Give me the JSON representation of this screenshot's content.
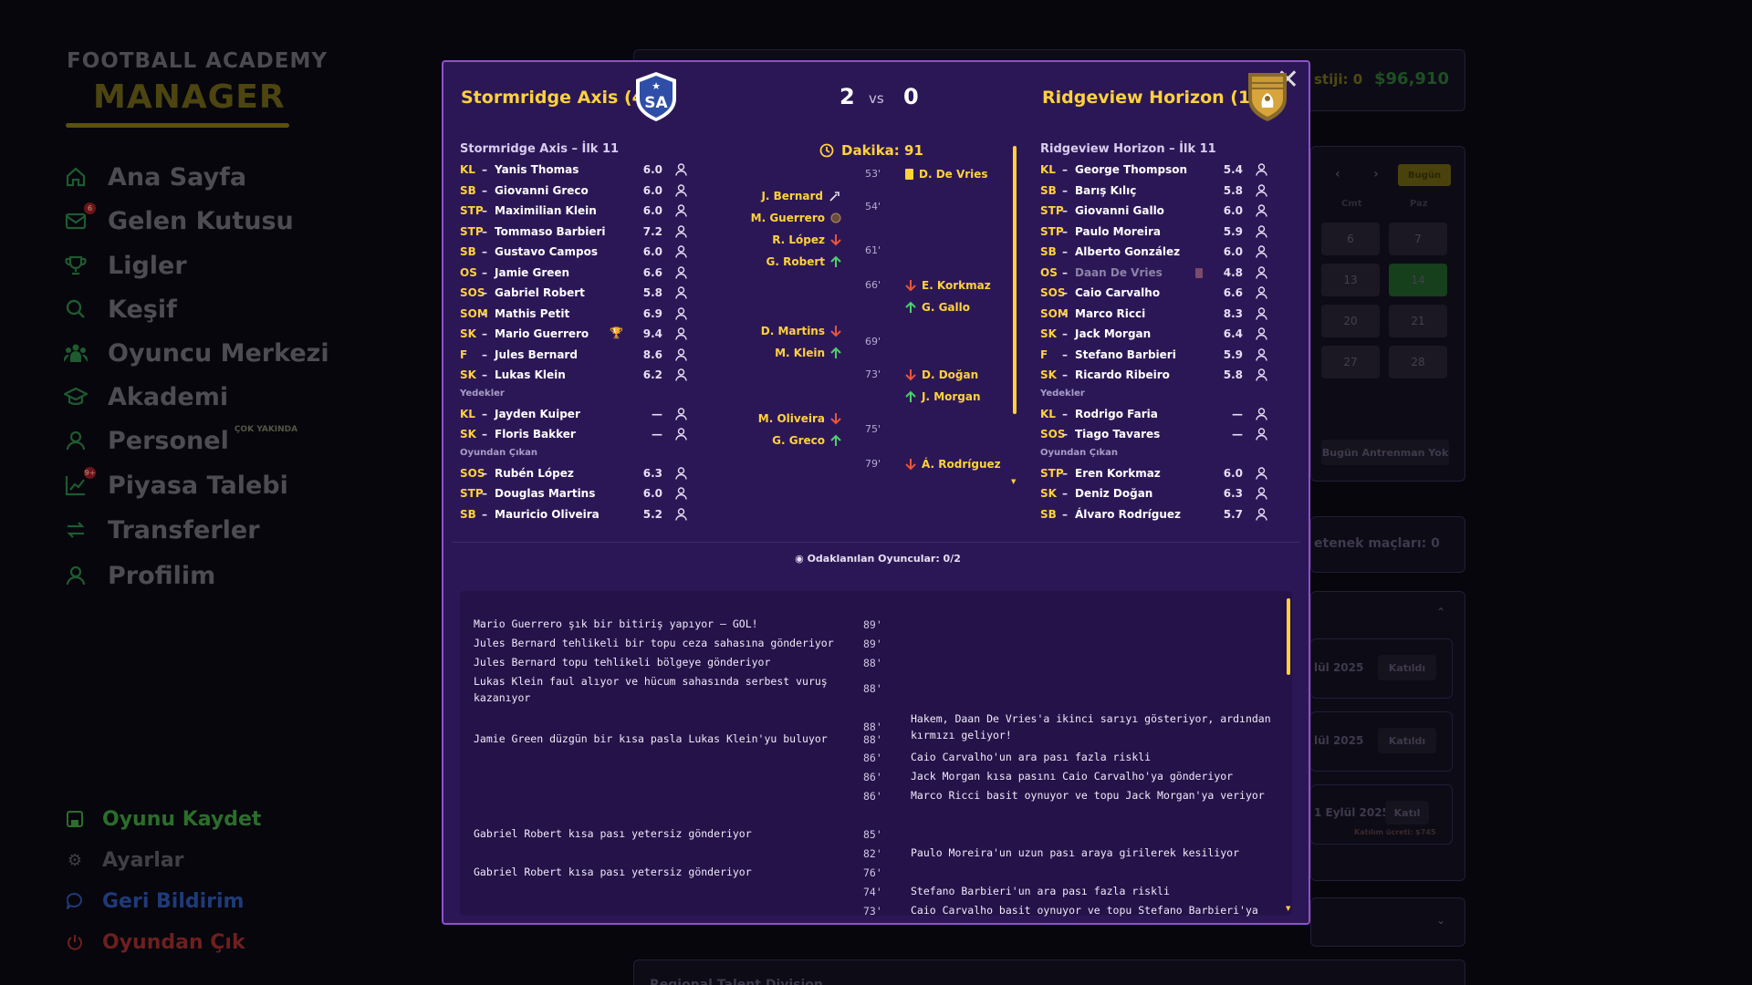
{
  "sidebar": {
    "logo_top": "FOOTBALL ACADEMY",
    "logo_main": "MANAGER",
    "items": [
      {
        "label": "Ana Sayfa"
      },
      {
        "label": "Gelen Kutusu",
        "badge": "6"
      },
      {
        "label": "Ligler"
      },
      {
        "label": "Keşif"
      },
      {
        "label": "Oyuncu Merkezi"
      },
      {
        "label": "Akademi"
      },
      {
        "label": "Personel",
        "note": "ÇOK YAKINDA"
      },
      {
        "label": "Piyasa Talebi",
        "badge": "9+"
      },
      {
        "label": "Transferler"
      },
      {
        "label": "Profilim"
      }
    ],
    "bottom": [
      {
        "label": "Oyunu Kaydet",
        "color": "#2a6e2a"
      },
      {
        "label": "Ayarlar",
        "color": "#3f3f45"
      },
      {
        "label": "Geri Bildirim",
        "color": "#1f3a78"
      },
      {
        "label": "Oyundan Çık",
        "color": "#6e1f1f"
      }
    ]
  },
  "background": {
    "prestige": "stiji: 0",
    "money": "$96,910",
    "today": "Bugün",
    "cal_head": [
      "Cmt",
      "Paz"
    ],
    "cal_days": [
      "6",
      "7",
      "13",
      "14",
      "20",
      "21",
      "27",
      "28"
    ],
    "no_training": "Bugün Antrenman Yok",
    "upcoming": "etenek maçları: 0",
    "rows": [
      {
        "date": "lül 2025",
        "btn": "Katıldı"
      },
      {
        "date": "lül 2025",
        "btn": "Katıldı"
      },
      {
        "date": "1 Eylül 2025",
        "btn": "Katıl",
        "fee": "Katılım ücreti: $745"
      }
    ],
    "bottom_title": "Regional Talent Division"
  },
  "match": {
    "home": {
      "name": "Stormridge Axis (4.)",
      "score": "2",
      "abbr": "SA"
    },
    "away": {
      "name": "Ridgeview Horizon (18.)",
      "score": "0"
    },
    "vs": "vs",
    "minute_label": "Dakika: 91",
    "focus_label": "Odaklanılan Oyuncular: 0/2"
  },
  "home_lineup": {
    "title": "Stormridge Axis – İlk 11",
    "starters": [
      {
        "pos": "KL",
        "name": "Yanis Thomas",
        "rating": "6.0"
      },
      {
        "pos": "SB",
        "name": "Giovanni Greco",
        "rating": "6.0"
      },
      {
        "pos": "STP",
        "name": "Maximilian Klein",
        "rating": "6.0"
      },
      {
        "pos": "STP",
        "name": "Tommaso Barbieri",
        "rating": "7.2"
      },
      {
        "pos": "SB",
        "name": "Gustavo Campos",
        "rating": "6.0"
      },
      {
        "pos": "OS",
        "name": "Jamie Green",
        "rating": "6.6"
      },
      {
        "pos": "SOS",
        "name": "Gabriel Robert",
        "rating": "5.8"
      },
      {
        "pos": "SOM",
        "name": "Mathis Petit",
        "rating": "6.9"
      },
      {
        "pos": "SK",
        "name": "Mario Guerrero",
        "rating": "9.4",
        "trophy": true
      },
      {
        "pos": "F",
        "name": "Jules Bernard",
        "rating": "8.6"
      },
      {
        "pos": "SK",
        "name": "Lukas Klein",
        "rating": "6.2"
      }
    ],
    "subs_label": "Yedekler",
    "subs": [
      {
        "pos": "KL",
        "name": "Jayden Kuiper",
        "rating": "—"
      },
      {
        "pos": "SK",
        "name": "Floris Bakker",
        "rating": "—"
      }
    ],
    "out_label": "Oyundan Çıkan",
    "out": [
      {
        "pos": "SOS",
        "name": "Rubén López",
        "rating": "6.3"
      },
      {
        "pos": "STP",
        "name": "Douglas Martins",
        "rating": "6.0"
      },
      {
        "pos": "SB",
        "name": "Mauricio Oliveira",
        "rating": "5.2"
      }
    ]
  },
  "away_lineup": {
    "title": "Ridgeview Horizon – İlk 11",
    "starters": [
      {
        "pos": "KL",
        "name": "George Thompson",
        "rating": "5.4"
      },
      {
        "pos": "SB",
        "name": "Barış Kılıç",
        "rating": "5.8"
      },
      {
        "pos": "STP",
        "name": "Giovanni Gallo",
        "rating": "6.0"
      },
      {
        "pos": "STP",
        "name": "Paulo Moreira",
        "rating": "5.9"
      },
      {
        "pos": "SB",
        "name": "Alberto González",
        "rating": "6.0"
      },
      {
        "pos": "OS",
        "name": "Daan De Vries",
        "rating": "4.8",
        "sent_off": true
      },
      {
        "pos": "SOS",
        "name": "Caio Carvalho",
        "rating": "6.6"
      },
      {
        "pos": "SOM",
        "name": "Marco Ricci",
        "rating": "8.3"
      },
      {
        "pos": "SK",
        "name": "Jack Morgan",
        "rating": "6.4"
      },
      {
        "pos": "F",
        "name": "Stefano Barbieri",
        "rating": "5.9"
      },
      {
        "pos": "SK",
        "name": "Ricardo Ribeiro",
        "rating": "5.8"
      }
    ],
    "subs_label": "Yedekler",
    "subs": [
      {
        "pos": "KL",
        "name": "Rodrigo Faria",
        "rating": "—"
      },
      {
        "pos": "SOS",
        "name": "Tiago Tavares",
        "rating": "—"
      }
    ],
    "out_label": "Oyundan Çıkan",
    "out": [
      {
        "pos": "STP",
        "name": "Eren Korkmaz",
        "rating": "6.0"
      },
      {
        "pos": "SK",
        "name": "Deniz Doğan",
        "rating": "6.3"
      },
      {
        "pos": "SB",
        "name": "Álvaro Rodríguez",
        "rating": "5.7"
      }
    ]
  },
  "events": [
    {
      "minute": "53'",
      "away": [
        {
          "name": "D. De Vries",
          "icon": "yellow-card"
        }
      ]
    },
    {
      "minute": "54'",
      "home": [
        {
          "name": "J. Bernard",
          "icon": "assist"
        },
        {
          "name": "M. Guerrero",
          "icon": "goal"
        }
      ]
    },
    {
      "minute": "61'",
      "home": [
        {
          "name": "R. López",
          "icon": "sub-out"
        },
        {
          "name": "G. Robert",
          "icon": "sub-in"
        }
      ]
    },
    {
      "minute": "66'",
      "away": [
        {
          "name": "E. Korkmaz",
          "icon": "sub-out"
        },
        {
          "name": "G. Gallo",
          "icon": "sub-in"
        }
      ]
    },
    {
      "minute": "69'",
      "home": [
        {
          "name": "D. Martins",
          "icon": "sub-out"
        },
        {
          "name": "M. Klein",
          "icon": "sub-in"
        }
      ]
    },
    {
      "minute": "73'",
      "away": [
        {
          "name": "D. Doğan",
          "icon": "sub-out"
        },
        {
          "name": "J. Morgan",
          "icon": "sub-in"
        }
      ]
    },
    {
      "minute": "75'",
      "home": [
        {
          "name": "M. Oliveira",
          "icon": "sub-out"
        },
        {
          "name": "G. Greco",
          "icon": "sub-in"
        }
      ]
    },
    {
      "minute": "79'",
      "away": [
        {
          "name": "Á. Rodríguez",
          "icon": "sub-out"
        }
      ]
    }
  ],
  "commentary": [
    {
      "side": "home",
      "text": "Mario Guerrero şık bir bitiriş yapıyor – GOL!",
      "minute": "89'"
    },
    {
      "side": "home",
      "text": "Jules Bernard tehlikeli bir topu ceza sahasına gönderiyor",
      "minute": "89'"
    },
    {
      "side": "home",
      "text": "Jules Bernard topu tehlikeli bölgeye gönderiyor",
      "minute": "88'"
    },
    {
      "side": "home",
      "text": "Lukas Klein faul alıyor ve hücum sahasında serbest vuruş\nkazanıyor",
      "minute": "88'"
    },
    {
      "side": "away",
      "text": "Hakem, Daan De Vries'a ikinci sarıyı gösteriyor, ardından\nkırmızı geliyor!",
      "minute": "88'"
    },
    {
      "side": "home",
      "text": "Jamie Green düzgün bir kısa pasla Lukas Klein'yu buluyor",
      "minute": "88'"
    },
    {
      "side": "away",
      "text": "Caio Carvalho'un ara pası fazla riskli",
      "minute": "86'"
    },
    {
      "side": "away",
      "text": "Jack Morgan kısa pasını Caio Carvalho'ya gönderiyor",
      "minute": "86'"
    },
    {
      "side": "away",
      "text": "Marco Ricci basit oynuyor ve topu Jack Morgan'ya veriyor",
      "minute": "86'"
    },
    {
      "side": "home",
      "text": "Gabriel Robert kısa pası yetersiz gönderiyor",
      "minute": "85'"
    },
    {
      "side": "away",
      "text": "Paulo Moreira'un uzun pası araya girilerek kesiliyor",
      "minute": "82'"
    },
    {
      "side": "home",
      "text": "Gabriel Robert kısa pası yetersiz gönderiyor",
      "minute": "76'"
    },
    {
      "side": "away",
      "text": "Stefano Barbieri'un ara pası fazla riskli",
      "minute": "74'"
    },
    {
      "side": "away",
      "text": "Caio Carvalho basit oynuyor ve topu Stefano Barbieri'ya",
      "minute": "73'"
    }
  ]
}
